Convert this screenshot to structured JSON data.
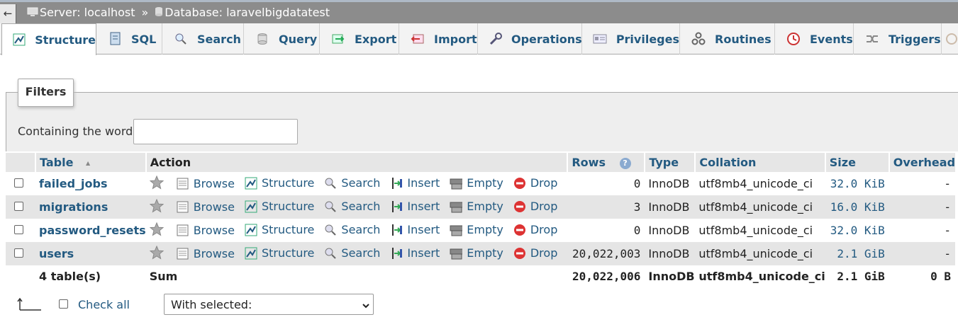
{
  "breadcrumb": {
    "back": "←",
    "server": "Server: localhost",
    "separator": "»",
    "database": "Database: laravelbigdatatest"
  },
  "tabs": [
    {
      "label": "Structure",
      "icon": "structure-icon",
      "active": true
    },
    {
      "label": "SQL",
      "icon": "sql-icon"
    },
    {
      "label": "Search",
      "icon": "search-icon"
    },
    {
      "label": "Query",
      "icon": "query-icon"
    },
    {
      "label": "Export",
      "icon": "export-icon"
    },
    {
      "label": "Import",
      "icon": "import-icon"
    },
    {
      "label": "Operations",
      "icon": "wrench-icon"
    },
    {
      "label": "Privileges",
      "icon": "privileges-icon"
    },
    {
      "label": "Routines",
      "icon": "routines-icon"
    },
    {
      "label": "Events",
      "icon": "events-icon"
    },
    {
      "label": "Triggers",
      "icon": "triggers-icon"
    }
  ],
  "filters": {
    "legend": "Filters",
    "label": "Containing the word:",
    "value": ""
  },
  "table": {
    "headers": {
      "table": "Table",
      "sort": "▲",
      "action": "Action",
      "rows": "Rows",
      "help": "?",
      "type": "Type",
      "collation": "Collation",
      "size": "Size",
      "overhead": "Overhead"
    },
    "actions": {
      "browse": "Browse",
      "structure": "Structure",
      "search": "Search",
      "insert": "Insert",
      "empty": "Empty",
      "drop": "Drop"
    },
    "rows": [
      {
        "name": "failed_jobs",
        "rows": "0",
        "type": "InnoDB",
        "collation": "utf8mb4_unicode_ci",
        "size": "32.0 KiB",
        "overhead": "-"
      },
      {
        "name": "migrations",
        "rows": "3",
        "type": "InnoDB",
        "collation": "utf8mb4_unicode_ci",
        "size": "16.0 KiB",
        "overhead": "-"
      },
      {
        "name": "password_resets",
        "rows": "0",
        "type": "InnoDB",
        "collation": "utf8mb4_unicode_ci",
        "size": "32.0 KiB",
        "overhead": "-"
      },
      {
        "name": "users",
        "rows": "20,022,003",
        "type": "InnoDB",
        "collation": "utf8mb4_unicode_ci",
        "size": "2.1 GiB",
        "overhead": "-"
      }
    ],
    "footer": {
      "count": "4 table(s)",
      "sum": "Sum",
      "rows": "20,022,006",
      "type": "InnoDB",
      "collation": "utf8mb4_unicode_ci",
      "size": "2.1 GiB",
      "overhead": "0 B"
    }
  },
  "bottom": {
    "check_all": "Check all",
    "with_selected": "With selected:"
  },
  "colors": {
    "link": "#235a81",
    "topbar": "#8c8c8c",
    "drop_red": "#d33"
  }
}
